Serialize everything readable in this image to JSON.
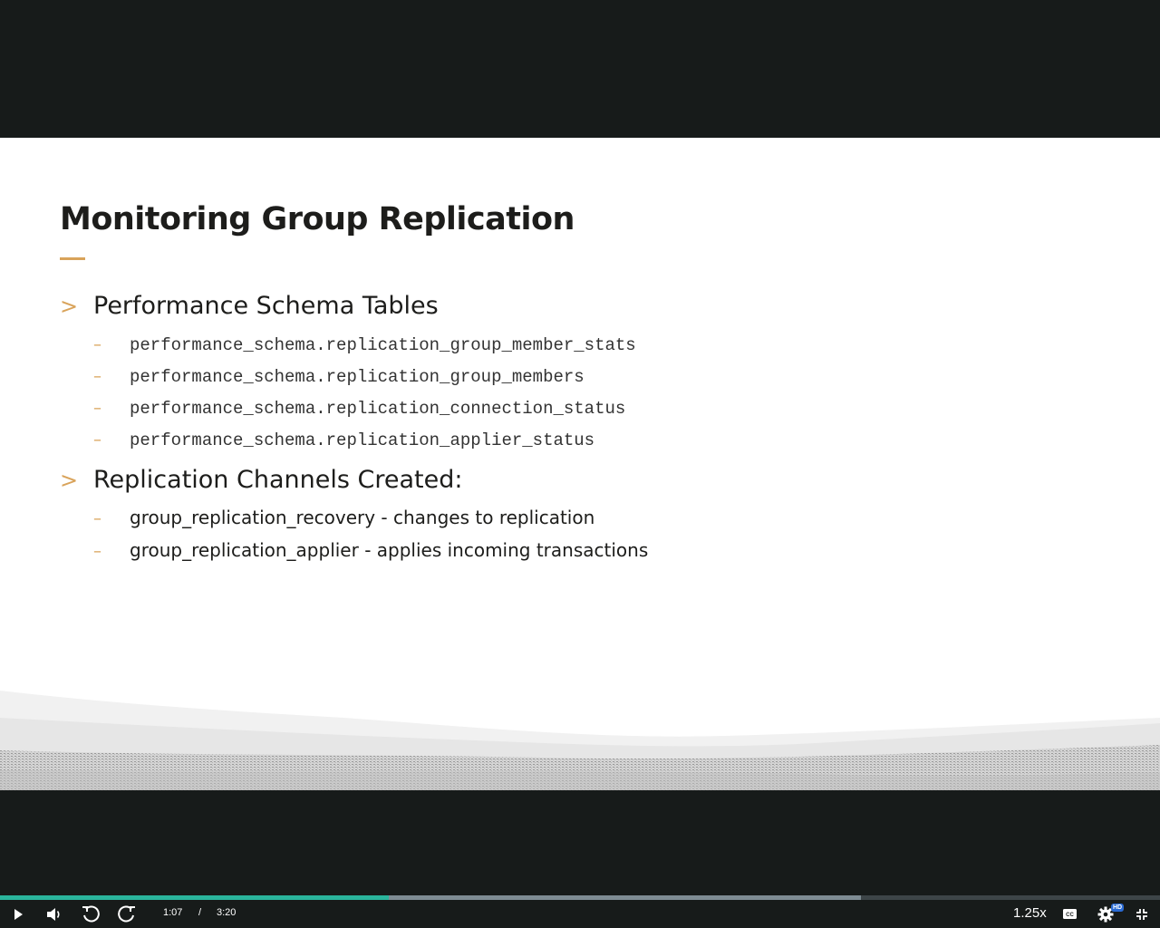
{
  "slide": {
    "title": "Monitoring Group Replication",
    "sections": [
      {
        "heading": "Performance Schema Tables",
        "items": [
          "performance_schema.replication_group_member_stats",
          "performance_schema.replication_group_members",
          "performance_schema.replication_connection_status",
          "performance_schema.replication_applier_status"
        ]
      },
      {
        "heading": "Replication Channels Created:",
        "items": [
          "group_replication_recovery - changes to replication",
          "group_replication_applier - applies incoming transactions"
        ]
      }
    ],
    "bullet_glyph": ">",
    "sub_bullet_glyph": "–",
    "accent_color": "#d9a35a"
  },
  "player": {
    "current_time": "1:07",
    "separator": "/",
    "duration": "3:20",
    "progress_fraction": 0.335,
    "buffered_fraction": 0.742,
    "speed": "1.25x",
    "quality_badge": "HD",
    "played_color": "#2ab59c",
    "controls": [
      "play-icon",
      "volume-icon",
      "rewind-icon",
      "forward-icon",
      "captions-icon",
      "settings-icon",
      "exit-fullscreen-icon"
    ]
  }
}
